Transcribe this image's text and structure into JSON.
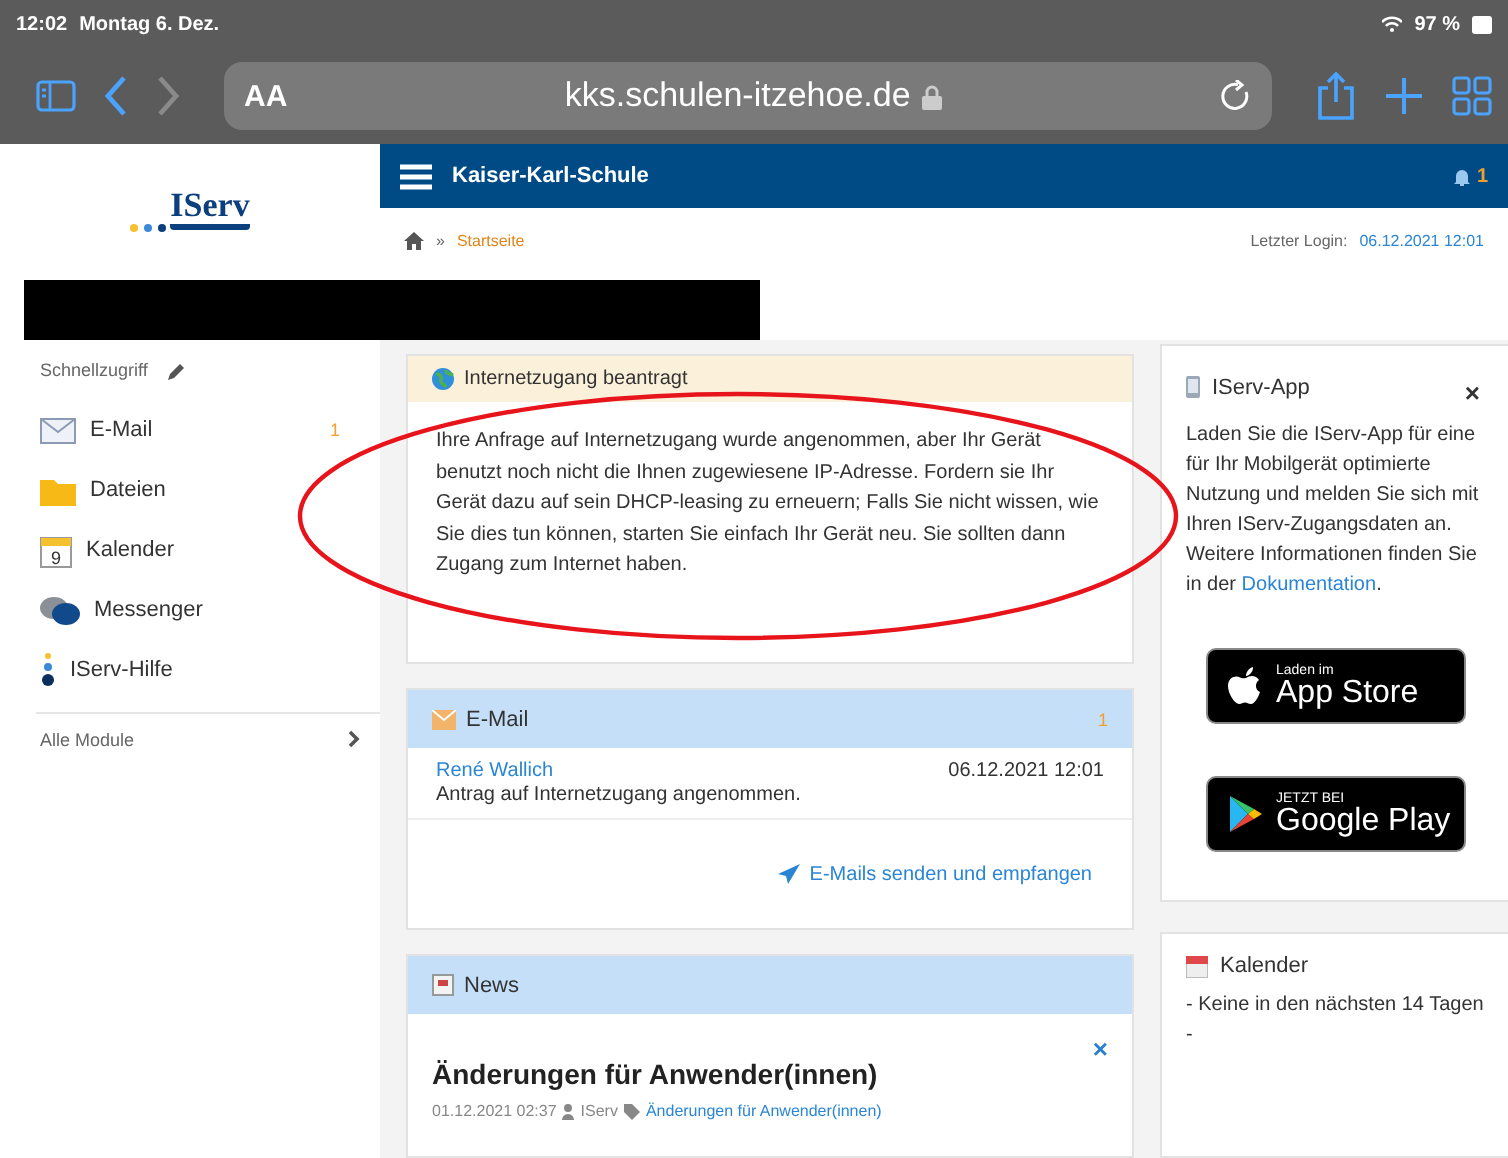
{
  "status_bar": {
    "time": "12:02",
    "date": "Montag 6. Dez.",
    "battery": "97 %"
  },
  "browser": {
    "text_size": "AA",
    "url": "kks.schulen-itzehoe.de"
  },
  "header": {
    "school": "Kaiser-Karl-Schule",
    "notifications": "1"
  },
  "breadcrumb": {
    "separator": "»",
    "page": "Startseite",
    "last_login_label": "Letzter Login:",
    "last_login": "06.12.2021 12:01"
  },
  "logo": {
    "text": "IServ"
  },
  "sidebar": {
    "title": "Schnellzugriff",
    "items": [
      {
        "kind": "mail",
        "label": "E-Mail",
        "badge": "1"
      },
      {
        "kind": "folder",
        "label": "Dateien"
      },
      {
        "kind": "calendar",
        "label": "Kalender",
        "day": "9"
      },
      {
        "kind": "chat",
        "label": "Messenger"
      },
      {
        "kind": "help",
        "label": "IServ-Hilfe"
      }
    ],
    "all_modules": "Alle Module"
  },
  "notice": {
    "title": "Internetzugang beantragt",
    "body": "Ihre Anfrage auf Internetzugang wurde angenommen, aber Ihr Gerät benutzt noch nicht die Ihnen zugewiesene IP-Adresse. Fordern sie Ihr Gerät dazu auf sein DHCP-leasing zu erneuern; Falls Sie nicht wissen, wie Sie dies tun können, starten Sie einfach Ihr Gerät neu. Sie sollten dann Zugang zum Internet haben."
  },
  "email": {
    "title": "E-Mail",
    "count": "1",
    "messages": [
      {
        "sender": "René Wallich",
        "date": "06.12.2021 12:01",
        "subject": "Antrag auf Internetzugang angenommen."
      }
    ],
    "link": "E-Mails senden und empfangen"
  },
  "news": {
    "title": "News",
    "items": [
      {
        "close": "×",
        "headline": "Änderungen für Anwender(innen)",
        "date": "01.12.2021 02:37",
        "author": "IServ",
        "category": "Änderungen für Anwender(innen)"
      }
    ]
  },
  "app_panel": {
    "title": "IServ-App",
    "close": "×",
    "body": "Laden Sie die IServ-App für eine für Ihr Mobilgerät optimierte Nutzung und melden Sie sich mit Ihren IServ-Zugangsdaten an. Weitere Informationen finden Sie in der",
    "link": "Dokumentation",
    "after": ".",
    "stores": [
      {
        "kind": "apple",
        "small": "Laden im",
        "big": "App Store"
      },
      {
        "kind": "google",
        "small": "JETZT BEI",
        "big": "Google Play"
      }
    ]
  },
  "calendar": {
    "title": "Kalender",
    "empty": "- Keine in den nächsten 14 Tagen -"
  }
}
